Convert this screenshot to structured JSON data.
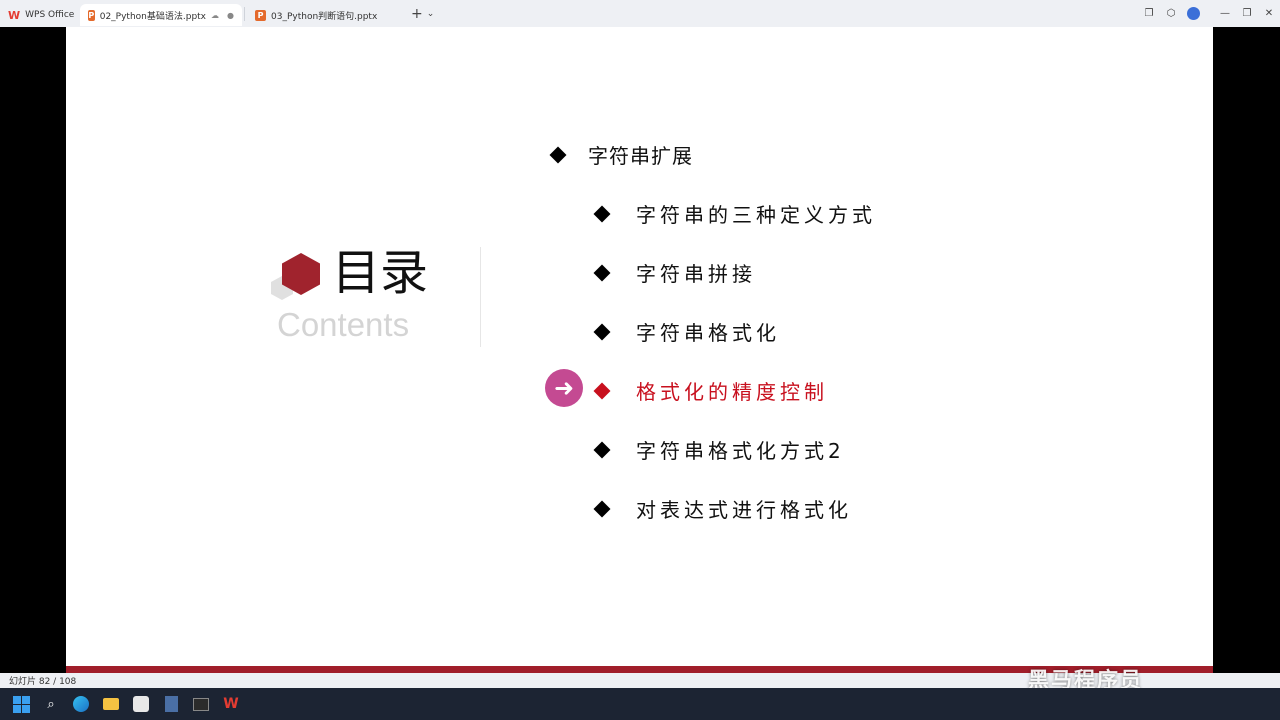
{
  "tabbar": {
    "home_label": "WPS Office",
    "tabs": [
      {
        "label": "02_Python基础语法.pptx",
        "active": true
      },
      {
        "label": "03_Python判断语句.pptx",
        "active": false
      }
    ],
    "new_tab": "+",
    "dropdown": "⌄"
  },
  "slide": {
    "title": "目录",
    "subtitle": "Contents",
    "items": [
      {
        "label": "字符串扩展",
        "level": 1,
        "active": false
      },
      {
        "label": "字符串的三种定义方式",
        "level": 2,
        "active": false
      },
      {
        "label": "字符串拼接",
        "level": 2,
        "active": false
      },
      {
        "label": "字符串格式化",
        "level": 2,
        "active": false
      },
      {
        "label": "格式化的精度控制",
        "level": 2,
        "active": true
      },
      {
        "label": "字符串格式化方式2",
        "level": 2,
        "active": false
      },
      {
        "label": "对表达式进行格式化",
        "level": 2,
        "active": false
      }
    ],
    "accent_color": "#a01e2a",
    "active_color": "#c8101e",
    "arrow_color": "#c44a92"
  },
  "status": {
    "slide_counter": "幻灯片 82 / 108"
  },
  "watermark": "黑马程序员"
}
